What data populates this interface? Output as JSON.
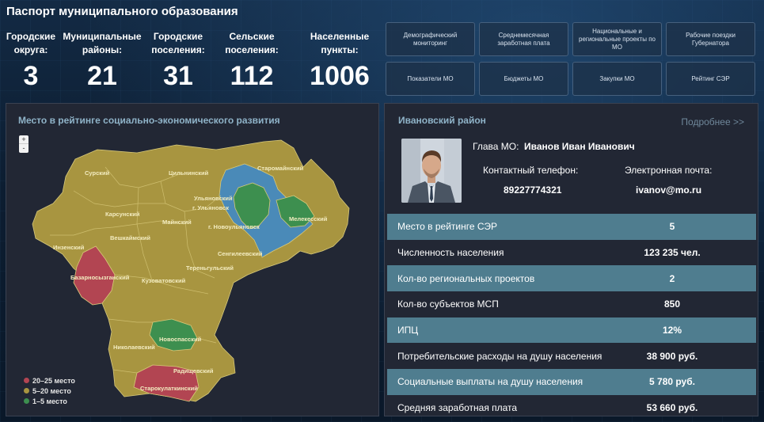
{
  "page": {
    "title": "Паспорт муниципального образования"
  },
  "stats": [
    {
      "label_line1": "Городские",
      "label_line2": "округа:",
      "value": "3"
    },
    {
      "label_line1": "Муниципальные",
      "label_line2": "районы:",
      "value": "21"
    },
    {
      "label_line1": "Городские",
      "label_line2": "поселения:",
      "value": "31"
    },
    {
      "label_line1": "Сельские",
      "label_line2": "поселения:",
      "value": "112"
    },
    {
      "label_line1": "Населенные",
      "label_line2": "пункты:",
      "value": "1006"
    }
  ],
  "nav": [
    "Демографический мониторинг",
    "Среднемесячная заработная плата",
    "Национальные и региональные проекты по МО",
    "Рабочие поездки Губернатора",
    "Показатели МО",
    "Бюджеты МО",
    "Закупки МО",
    "Рейтинг СЭР"
  ],
  "map": {
    "title": "Место в рейтинге социально-экономического развития",
    "zoom_in": "+",
    "zoom_out": "-",
    "colors": {
      "top": "#3d8f4f",
      "mid": "#a89540",
      "low": "#b24552",
      "water": "#4a8ab8"
    },
    "districts": [
      "Сурский",
      "Цильнинский",
      "Старомайнский",
      "Ульяновский",
      "г. Ульяновск",
      "Карсунский",
      "Майнский",
      "г. Новоульяновск",
      "Мелекесский",
      "Вешкаймский",
      "Инзенский",
      "Сенгилеевский",
      "Тереньгульский",
      "Базарносызганский",
      "Кузоватовский",
      "Новоспасский",
      "Николаевский",
      "Радищевский",
      "Старокулаткинский"
    ],
    "legend": [
      {
        "label": "20–25 место",
        "color": "#b24552"
      },
      {
        "label": "5–20 место",
        "color": "#a89540"
      },
      {
        "label": "1–5 место",
        "color": "#3d8f4f"
      }
    ]
  },
  "info": {
    "title": "Ивановский район",
    "more_label": "Подробнее >>",
    "head_label": "Глава МО:",
    "head_name": "Иванов Иван Иванович",
    "phone_label": "Контактный телефон:",
    "phone_value": "89227774321",
    "email_label": "Электронная почта:",
    "email_value": "ivanov@mo.ru",
    "rows": [
      {
        "key": "Место в рейтинге СЭР",
        "value": "5"
      },
      {
        "key": "Численность населения",
        "value": "123 235 чел."
      },
      {
        "key": "Кол-во региональных проектов",
        "value": "2"
      },
      {
        "key": "Кол-во субъектов МСП",
        "value": "850"
      },
      {
        "key": "ИПЦ",
        "value": "12%"
      },
      {
        "key": "Потребительские расходы на душу населения",
        "value": "38 900 руб."
      },
      {
        "key": "Социальные выплаты на душу населения",
        "value": "5 780 руб."
      },
      {
        "key": "Средняя заработная плата",
        "value": "53 660 руб."
      }
    ]
  }
}
